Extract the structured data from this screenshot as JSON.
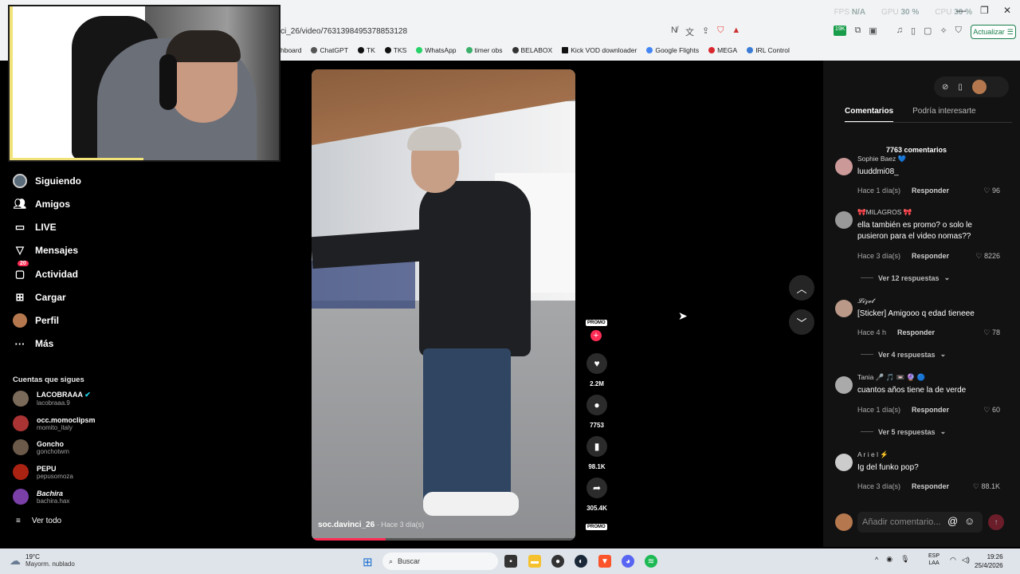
{
  "browser": {
    "url": "ci_26/video/7631398495378853128",
    "stats": [
      {
        "label": "FPS",
        "value": "N/A"
      },
      {
        "label": "GPU",
        "value": "30 %"
      },
      {
        "label": "CPU",
        "value": "30 %"
      }
    ],
    "update_label": "Actualizar",
    "bookmarks": [
      "hboard",
      "ChatGPT",
      "TK",
      "TKS",
      "WhatsApp",
      "timer obs",
      "BELABOX",
      "Kick VOD downloader",
      "Google Flights",
      "MEGA",
      "IRL Control"
    ],
    "ext_badge": "19K"
  },
  "sidebar": {
    "items": [
      {
        "label": "Siguiendo",
        "icon": "following-icon"
      },
      {
        "label": "Amigos",
        "icon": "friends-icon"
      },
      {
        "label": "LIVE",
        "icon": "live-icon"
      },
      {
        "label": "Mensajes",
        "icon": "messages-icon"
      },
      {
        "label": "Actividad",
        "icon": "activity-icon",
        "badge": "20"
      },
      {
        "label": "Cargar",
        "icon": "upload-icon"
      },
      {
        "label": "Perfil",
        "icon": "profile-icon"
      },
      {
        "label": "Más",
        "icon": "more-icon"
      }
    ],
    "following_heading": "Cuentas que sigues",
    "accounts": [
      {
        "name": "LACOBRAAA",
        "handle": "lacobraaa.9",
        "color": "#7a6a5a"
      },
      {
        "name": "occ.momoclipsm",
        "handle": "momito_italy",
        "color": "#a33"
      },
      {
        "name": "Goncho",
        "handle": "gonchotwm",
        "color": "#6b5a4a"
      },
      {
        "name": "PEPU",
        "handle": "pepusomoza",
        "color": "#a21"
      },
      {
        "name": "Bachira",
        "handle": "bachira.hax",
        "color": "#7b3fa8"
      }
    ],
    "see_all": "Ver todo"
  },
  "video": {
    "username": "soc.davinci_26",
    "time": " · Hace 3 día(s)",
    "progress": 0.28
  },
  "actions": {
    "promo": "PROMO",
    "likes": "2.2M",
    "comments": "7753",
    "saves": "98.1K",
    "shares": "305.4K"
  },
  "comments_panel": {
    "tabs": [
      "Comentarios",
      "Podría interesarte"
    ],
    "count_label": "7763 comentarios",
    "reply_label": "Responder",
    "comments": [
      {
        "user": "Sophie Baez 💙",
        "text": "luuddmi08_",
        "time": "Hace 1 día(s)",
        "likes": "96",
        "color": "#c99"
      },
      {
        "user": "🎀MILAGROS 🎀",
        "text": "ella también es promo? o solo le pusieron para el video nomas??",
        "time": "Hace 3 día(s)",
        "likes": "8226",
        "color": "#999"
      },
      {
        "user": "𝓛𝓲𝔃𝓮𝓽",
        "text": "[Sticker] Amigooo q edad tieneee",
        "time": "Hace 4 h",
        "likes": "78",
        "color": "#b98"
      },
      {
        "user": "Tania 🎤 🎵 📼 🔮 🔵",
        "text": "cuantos años tiene la de verde",
        "time": "Hace 1 día(s)",
        "likes": "60",
        "color": "#aaa"
      },
      {
        "user": "A r i e l ⚡",
        "text": "Ig del funko pop?",
        "time": "Hace 3 día(s)",
        "likes": "88.1K",
        "color": "#ccc"
      }
    ],
    "replies": [
      "Ver 12 respuestas",
      "Ver 4 respuestas",
      "Ver 5 respuestas"
    ],
    "input_placeholder": "Añadir comentario..."
  },
  "taskbar": {
    "temp": "19°C",
    "weather": "Mayorm. nublado",
    "search": "Buscar",
    "lang1": "ESP",
    "lang2": "LAA",
    "time": "19:26",
    "date": "25/4/2026"
  }
}
